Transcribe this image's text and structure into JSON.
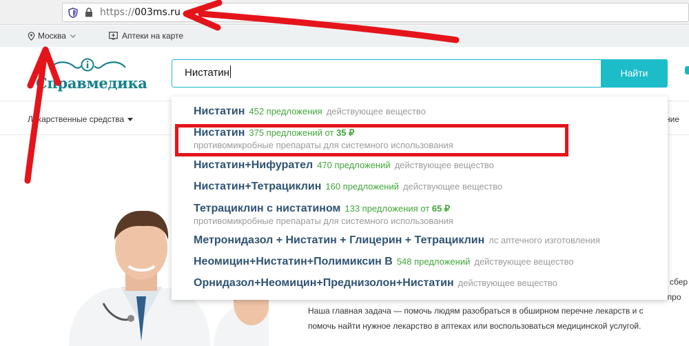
{
  "browser": {
    "url_prefix": "https://",
    "url_domain": "003ms.ru"
  },
  "top_strip": {
    "city": "Москва",
    "map_link": "Аптеки на карте"
  },
  "header": {
    "logo_text": "Справмедика",
    "search_value": "Нистатин",
    "search_button": "Найти"
  },
  "nav": {
    "first_item": "Лекарственные средства",
    "right_partial": "ние"
  },
  "suggestions": [
    {
      "name": "Нистатин",
      "count": "452 предложения",
      "price_prefix": "",
      "price": "",
      "kind": "действующее вещество",
      "sub": ""
    },
    {
      "name": "Нистатин",
      "count": "375 предложений",
      "price_prefix": "от",
      "price": "35 ₽",
      "kind": "",
      "sub": "противомикробные препараты для системного использования"
    },
    {
      "name": "Нистатин+Нифурател",
      "count": "470 предложений",
      "price_prefix": "",
      "price": "",
      "kind": "действующее вещество",
      "sub": ""
    },
    {
      "name": "Нистатин+Тетрациклин",
      "count": "160 предложений",
      "price_prefix": "",
      "price": "",
      "kind": "действующее вещество",
      "sub": ""
    },
    {
      "name": "Тетрациклин с нистатином",
      "count": "133 предложения",
      "price_prefix": "от",
      "price": "65 ₽",
      "kind": "",
      "sub": "противомикробные препараты для системного использования"
    },
    {
      "name": "Метронидазол + Нистатин + Глицерин + Тетрациклин",
      "count": "",
      "price_prefix": "",
      "price": "",
      "kind": "лс аптечного изготовления",
      "sub": ""
    },
    {
      "name": "Неомицин+Нистатин+Полимиксин B",
      "count": "548 предложений",
      "price_prefix": "",
      "price": "",
      "kind": "действующее вещество",
      "sub": ""
    },
    {
      "name": "Орнидазол+Неомицин+Преднизолон+Нистатин",
      "count": "",
      "price_prefix": "",
      "price": "",
      "kind": "действующее вещество",
      "sub": ""
    }
  ],
  "body": {
    "line1": "Наша главная задача — помочь людям разобраться в обширном перечне лекарств и с",
    "line2": "помочь найти нужное лекарство в аптеках или воспользоваться медицинской услугой.",
    "edge1": "сбер",
    "edge2": "опро"
  },
  "colors": {
    "accent": "#1cbcc9",
    "link": "#2e5373",
    "green": "#43a53b",
    "muted": "#9b9b9b",
    "annotation": "#e5141b"
  }
}
